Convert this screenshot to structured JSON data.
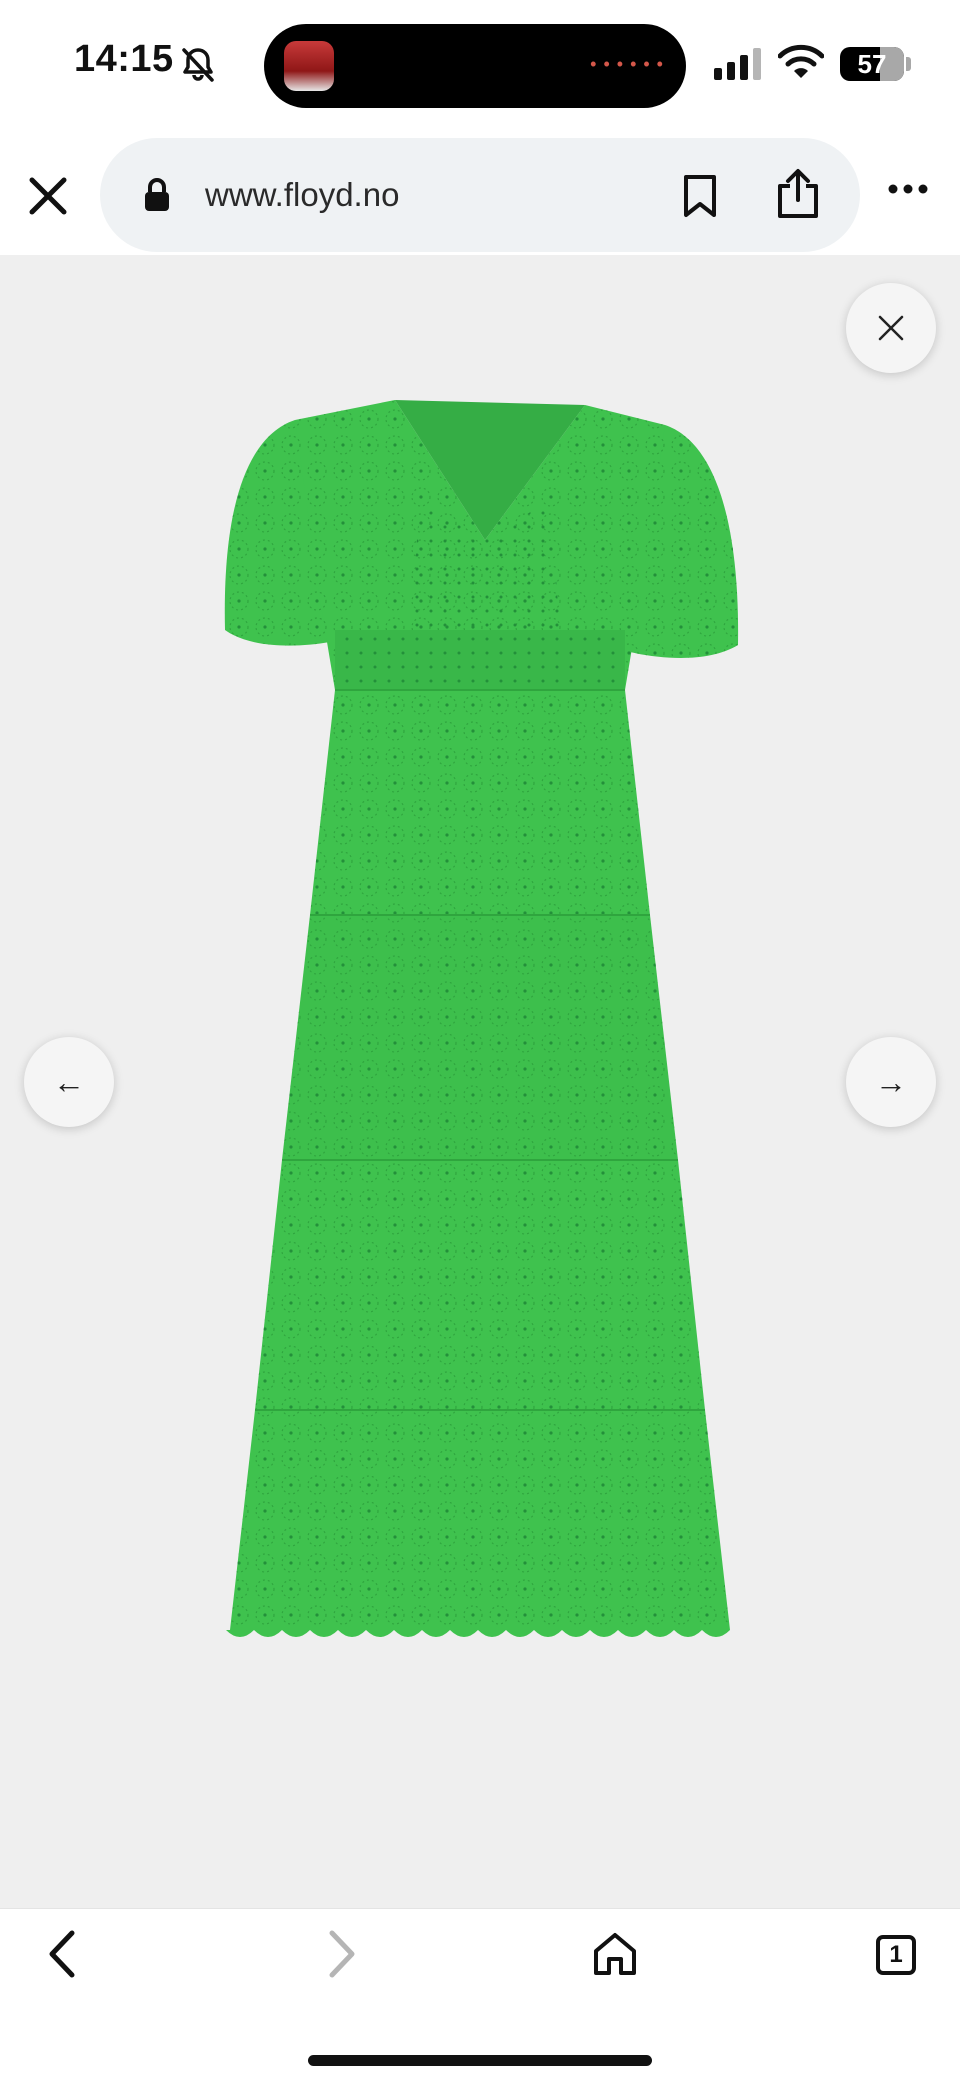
{
  "status_bar": {
    "time": "14:15",
    "battery": "57"
  },
  "browser": {
    "url": "www.floyd.no"
  },
  "viewer": {
    "prev_glyph": "←",
    "next_glyph": "→",
    "product_color": "#3fc24e"
  },
  "toolbar": {
    "tab_count": "1"
  },
  "icons": [
    "bell-slash-icon",
    "signal-icon",
    "wifi-icon",
    "battery-icon",
    "close-icon",
    "lock-icon",
    "bookmark-icon",
    "share-icon",
    "more-icon",
    "back-icon",
    "forward-icon",
    "home-icon",
    "tabs-icon"
  ]
}
